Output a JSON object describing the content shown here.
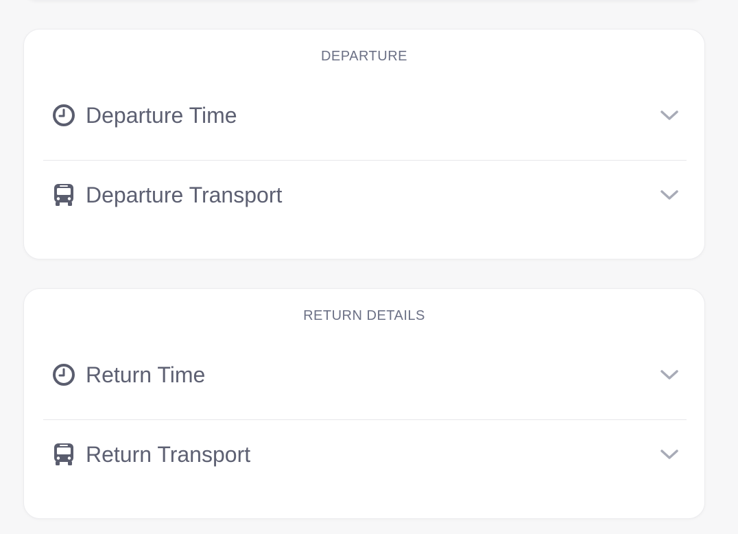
{
  "sections": [
    {
      "title": "DEPARTURE",
      "items": [
        {
          "label": "Departure Time",
          "icon": "clock-icon"
        },
        {
          "label": "Departure Transport",
          "icon": "bus-icon"
        }
      ]
    },
    {
      "title": "RETURN DETAILS",
      "items": [
        {
          "label": "Return Time",
          "icon": "clock-icon"
        },
        {
          "label": "Return Transport",
          "icon": "bus-icon"
        }
      ]
    }
  ],
  "colors": {
    "text": "#5d6072",
    "title": "#6b7085",
    "icon": "#5a5d6e",
    "chevron": "#a8abb7",
    "divider": "#e6e6ea"
  }
}
